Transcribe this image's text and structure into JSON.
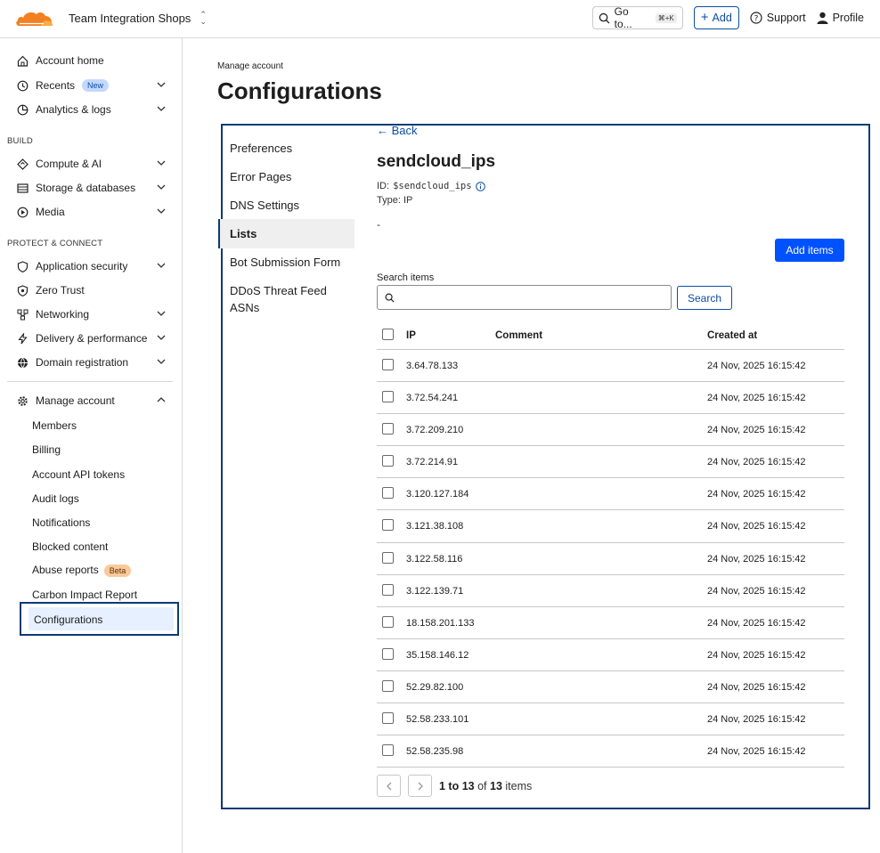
{
  "topbar": {
    "account_name": "Team Integration Shops",
    "goto_label": "Go to...",
    "goto_shortcut": "⌘+K",
    "add_label": "Add",
    "support_label": "Support",
    "profile_label": "Profile",
    "brand_color": "#f38020"
  },
  "sidebar": {
    "account_home": "Account home",
    "recents": "Recents",
    "recents_badge": "New",
    "analytics": "Analytics & logs",
    "build_label": "BUILD",
    "compute": "Compute & AI",
    "storage": "Storage & databases",
    "media": "Media",
    "protect_label": "PROTECT & CONNECT",
    "app_security": "Application security",
    "zero_trust": "Zero Trust",
    "networking": "Networking",
    "delivery": "Delivery & performance",
    "domain_reg": "Domain registration",
    "manage_account": "Manage account",
    "sub": {
      "members": "Members",
      "billing": "Billing",
      "api_tokens": "Account API tokens",
      "audit_logs": "Audit logs",
      "notifications": "Notifications",
      "blocked": "Blocked content",
      "abuse": "Abuse reports",
      "abuse_badge": "Beta",
      "carbon": "Carbon Impact Report",
      "configurations": "Configurations"
    }
  },
  "main": {
    "breadcrumb": "Manage account",
    "title": "Configurations",
    "subnav": {
      "preferences": "Preferences",
      "error_pages": "Error Pages",
      "dns_settings": "DNS Settings",
      "lists": "Lists",
      "bot_form": "Bot Submission Form",
      "ddos": "DDoS Threat Feed ASNs"
    },
    "back_label": "← Back",
    "list_name": "sendcloud_ips",
    "id_label": "ID:",
    "id_value": "$sendcloud_ips",
    "type_label": "Type: IP",
    "description": "-",
    "add_items_label": "Add items",
    "search_label": "Search items",
    "search_placeholder": "",
    "search_button": "Search",
    "table": {
      "col_ip": "IP",
      "col_comment": "Comment",
      "col_created": "Created at",
      "rows": [
        {
          "ip": "3.64.78.133",
          "comment": "",
          "created": "24 Nov, 2025 16:15:42"
        },
        {
          "ip": "3.72.54.241",
          "comment": "",
          "created": "24 Nov, 2025 16:15:42"
        },
        {
          "ip": "3.72.209.210",
          "comment": "",
          "created": "24 Nov, 2025 16:15:42"
        },
        {
          "ip": "3.72.214.91",
          "comment": "",
          "created": "24 Nov, 2025 16:15:42"
        },
        {
          "ip": "3.120.127.184",
          "comment": "",
          "created": "24 Nov, 2025 16:15:42"
        },
        {
          "ip": "3.121.38.108",
          "comment": "",
          "created": "24 Nov, 2025 16:15:42"
        },
        {
          "ip": "3.122.58.116",
          "comment": "",
          "created": "24 Nov, 2025 16:15:42"
        },
        {
          "ip": "3.122.139.71",
          "comment": "",
          "created": "24 Nov, 2025 16:15:42"
        },
        {
          "ip": "18.158.201.133",
          "comment": "",
          "created": "24 Nov, 2025 16:15:42"
        },
        {
          "ip": "35.158.146.12",
          "comment": "",
          "created": "24 Nov, 2025 16:15:42"
        },
        {
          "ip": "52.29.82.100",
          "comment": "",
          "created": "24 Nov, 2025 16:15:42"
        },
        {
          "ip": "52.58.233.101",
          "comment": "",
          "created": "24 Nov, 2025 16:15:42"
        },
        {
          "ip": "52.58.235.98",
          "comment": "",
          "created": "24 Nov, 2025 16:15:42"
        }
      ]
    },
    "pager": {
      "range": "1 to 13",
      "of": "of",
      "total": "13",
      "unit": "items"
    }
  }
}
